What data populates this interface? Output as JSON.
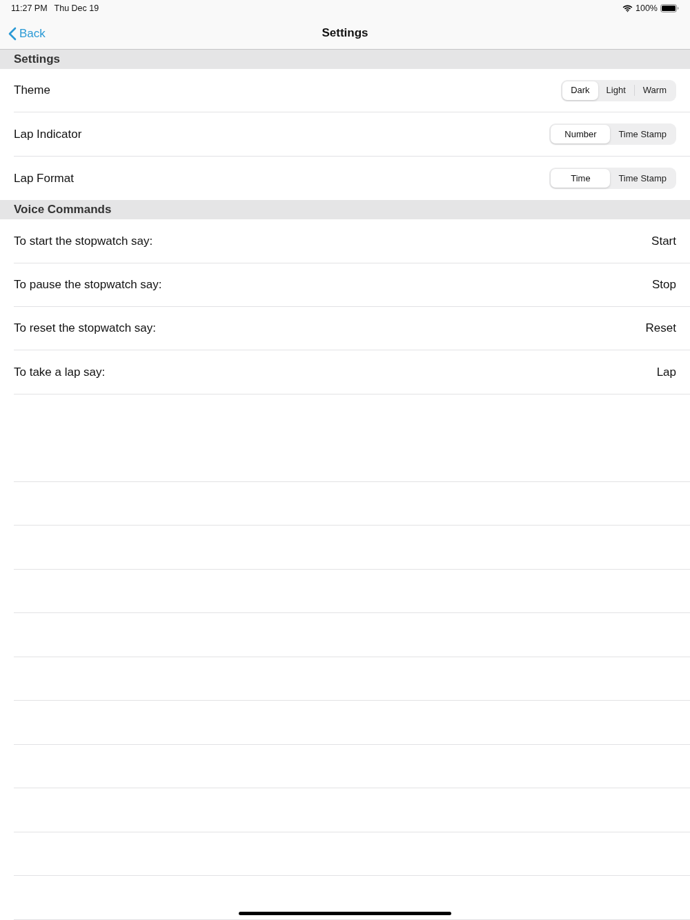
{
  "status_bar": {
    "time": "11:27 PM",
    "date": "Thu Dec 19",
    "battery": "100%"
  },
  "nav_bar": {
    "back": "Back",
    "title": "Settings"
  },
  "sections": [
    {
      "title": "Settings",
      "rows": [
        {
          "kind": "segmented",
          "label": "Theme",
          "segments": [
            {
              "label": "Dark",
              "selected": true
            },
            {
              "label": "Light",
              "selected": false
            },
            {
              "label": "Warm",
              "selected": false
            }
          ]
        },
        {
          "kind": "segmented",
          "label": "Lap Indicator",
          "segments": [
            {
              "label": "Number",
              "selected": true
            },
            {
              "label": "Time Stamp",
              "selected": false
            }
          ]
        },
        {
          "kind": "segmented",
          "label": "Lap Format",
          "segments": [
            {
              "label": "Time",
              "selected": true
            },
            {
              "label": "Time Stamp",
              "selected": false
            }
          ]
        }
      ]
    },
    {
      "title": "Voice Commands",
      "rows": [
        {
          "kind": "value",
          "label": "To start the stopwatch say:",
          "value": "Start"
        },
        {
          "kind": "value",
          "label": "To pause the stopwatch say:",
          "value": "Stop"
        },
        {
          "kind": "value",
          "label": "To reset the stopwatch say:",
          "value": "Reset"
        },
        {
          "kind": "value",
          "label": "To take a lap say:",
          "value": "Lap"
        }
      ]
    }
  ]
}
